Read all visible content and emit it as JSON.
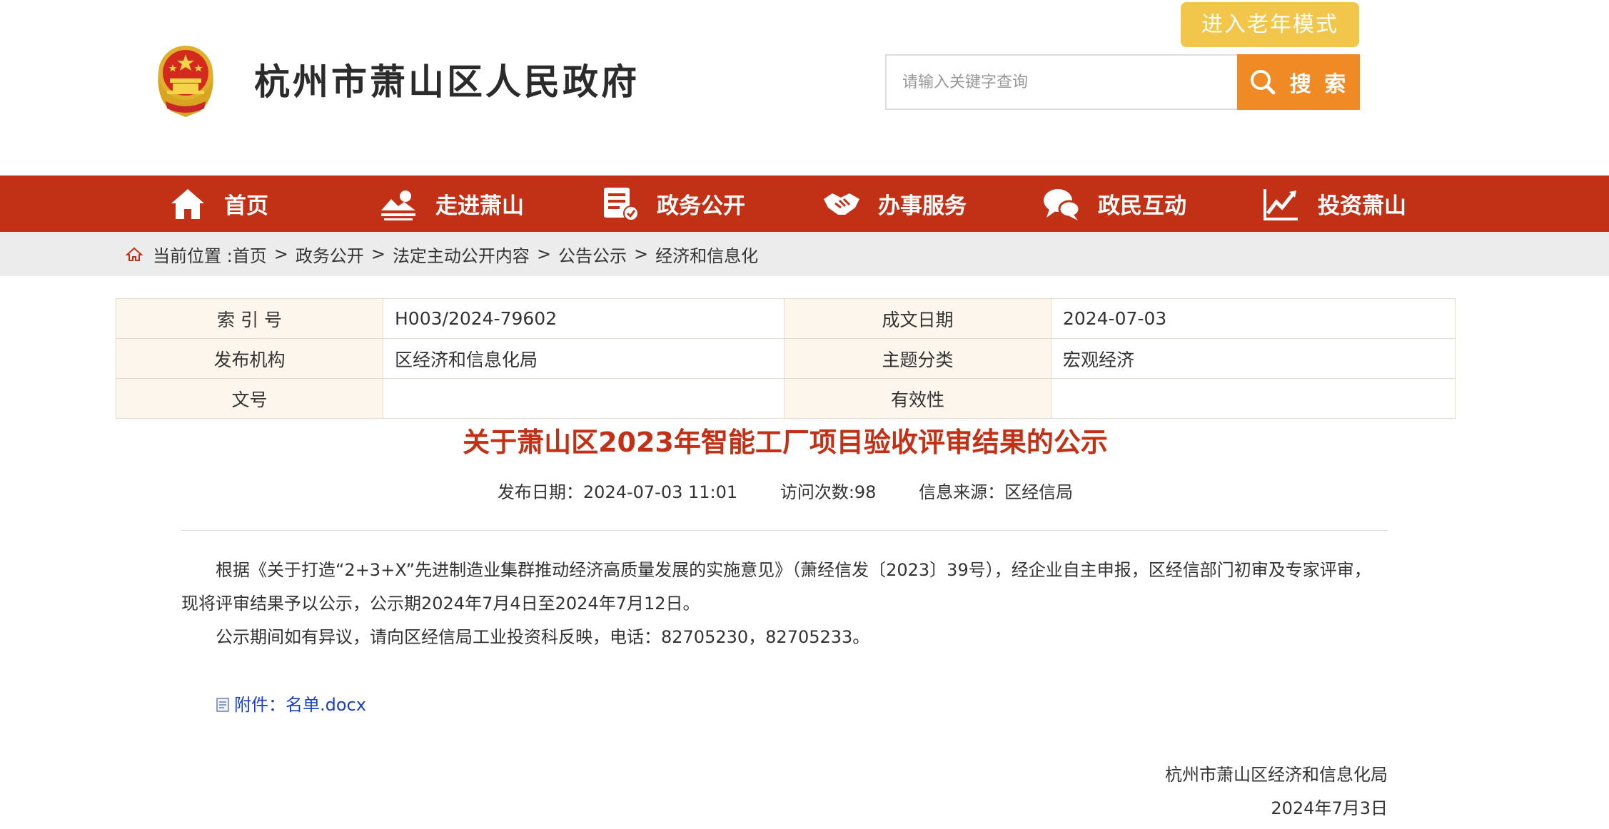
{
  "header": {
    "site_title": "杭州市萧山区人民政府",
    "elder_mode": "进入老年模式",
    "search_placeholder": "请输入关键字查询",
    "search_button": "搜 索"
  },
  "nav": [
    {
      "label": "首页",
      "icon": "home-icon"
    },
    {
      "label": "走进萧山",
      "icon": "landscape-icon"
    },
    {
      "label": "政务公开",
      "icon": "document-icon"
    },
    {
      "label": "办事服务",
      "icon": "handshake-icon"
    },
    {
      "label": "政民互动",
      "icon": "chat-icon"
    },
    {
      "label": "投资萧山",
      "icon": "chart-icon"
    }
  ],
  "breadcrumb": {
    "prefix": "当前位置 :",
    "items": [
      "首页",
      "政务公开",
      "法定主动公开内容",
      "公告公示",
      "经济和信息化"
    ]
  },
  "info": {
    "index_label": "索 引 号",
    "index_value": "H003/2024-79602",
    "date_label": "成文日期",
    "date_value": "2024-07-03",
    "org_label": "发布机构",
    "org_value": "区经济和信息化局",
    "topic_label": "主题分类",
    "topic_value": "宏观经济",
    "docno_label": "文号",
    "docno_value": "",
    "valid_label": "有效性",
    "valid_value": ""
  },
  "article": {
    "title": "关于萧山区2023年智能工厂项目验收评审结果的公示",
    "publish_date": "发布日期：2024-07-03 11:01",
    "visits": "访问次数:98",
    "source": "信息来源：区经信局",
    "para1": "根据《关于打造“2+3+X”先进制造业集群推动经济高质量发展的实施意见》（萧经信发〔2023〕39号），经企业自主申报，区经信部门初审及专家评审，现将评审结果予以公示，公示期2024年7月4日至2024年7月12日。",
    "para2": "公示期间如有异议，请向区经信局工业投资科反映，电话：82705230，82705233。",
    "attachment": "附件：名单.docx",
    "sign_org": "杭州市萧山区经济和信息化局",
    "sign_date": "2024年7月3日"
  },
  "colors": {
    "nav_red": "#c23116",
    "title_red": "#c23116",
    "search_orange": "#f08a24",
    "elder_yellow": "#f2c64a",
    "link_blue": "#1a3fc7"
  }
}
